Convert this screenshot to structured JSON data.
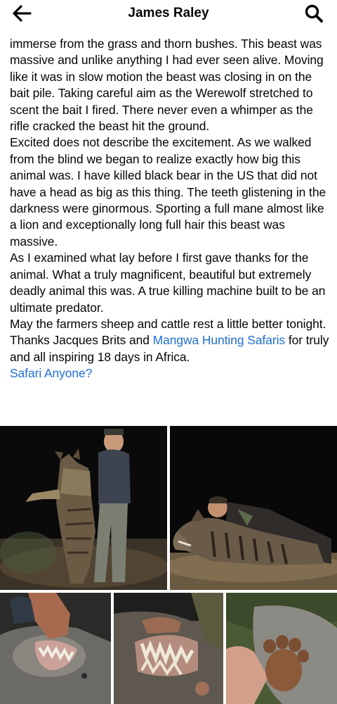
{
  "header": {
    "title": "James Raley",
    "back_icon": "arrow-left-icon",
    "search_icon": "search-icon"
  },
  "post": {
    "paragraphs": [
      "immerse from the grass and thorn bushes.   This beast was massive and unlike anything I had ever seen alive.   Moving like it was in slow motion the beast was closing in on the bait pile.   Taking careful aim as the Werewolf stretched to scent the bait I fired.   There never even a whimper as the rifle cracked the beast hit the ground.",
      "Excited does not describe the excitement.   As we walked from the blind we began to realize exactly how big this animal was.   I have killed black bear in the US that did not have a head as big as this thing.   The teeth glistening in the darkness were ginormous.   Sporting a full mane almost like a lion and exceptionally long full hair this beast was massive.",
      "As I examined what lay before I first gave thanks for the animal.  What a truly magnificent, beautiful but extremely deadly animal this was.   A true killing machine built to be an ultimate predator.",
      "May the farmers sheep and cattle rest a little better tonight."
    ],
    "thanks_prefix": "Thanks Jacques Brits and ",
    "thanks_link": "Mangwa Hunting Safaris",
    "thanks_suffix": " for truly and all inspiring 18 days in Africa.",
    "hashtag_link": "Safari Anyone?",
    "link_color": "#1f6ed4"
  },
  "photos": [
    {
      "name": "photo-hunter-holding-hyena"
    },
    {
      "name": "photo-hunter-lying-with-hyena"
    },
    {
      "name": "photo-hyena-mouth-hand"
    },
    {
      "name": "photo-hyena-teeth-closeup"
    },
    {
      "name": "photo-hyena-paw"
    }
  ]
}
